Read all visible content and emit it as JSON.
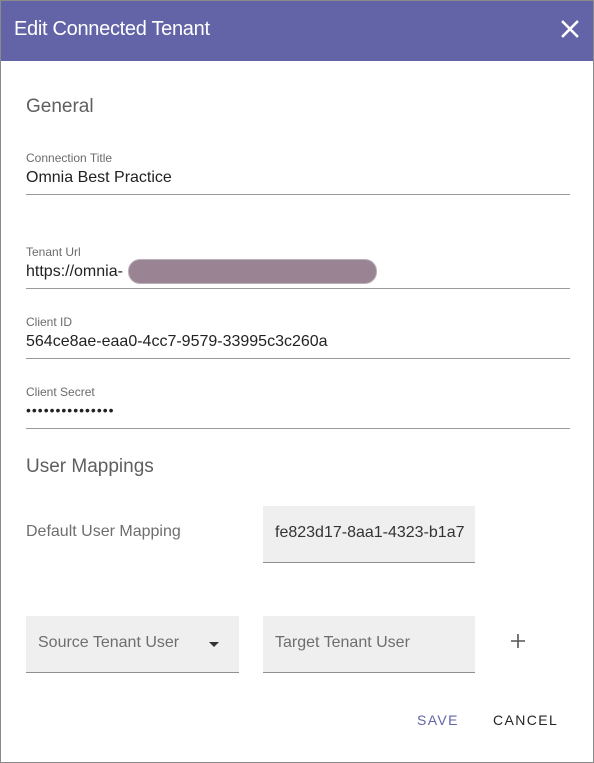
{
  "dialog": {
    "title": "Edit Connected Tenant",
    "close_icon": "close-icon"
  },
  "general": {
    "heading": "General",
    "connection_title": {
      "label": "Connection Title",
      "value": "Omnia Best Practice"
    },
    "tenant_url": {
      "label": "Tenant Url",
      "value": "https://omnia-"
    },
    "client_id": {
      "label": "Client ID",
      "value": "564ce8ae-eaa0-4cc7-9579-33995c3c260a"
    },
    "client_secret": {
      "label": "Client Secret",
      "value": "•••••••••••••••"
    }
  },
  "user_mappings": {
    "heading": "User Mappings",
    "default_mapping_label": "Default User Mapping",
    "default_mapping_value": "fe823d17-8aa1-4323-b1a7",
    "source_placeholder": "Source Tenant User",
    "target_placeholder": "Target Tenant User",
    "add_icon": "plus-icon",
    "dropdown_icon": "caret-down-icon"
  },
  "actions": {
    "save_label": "SAVE",
    "cancel_label": "CANCEL"
  },
  "colors": {
    "header_bg": "#6264a7",
    "save_text": "#6264a7",
    "cancel_text": "#252525"
  }
}
